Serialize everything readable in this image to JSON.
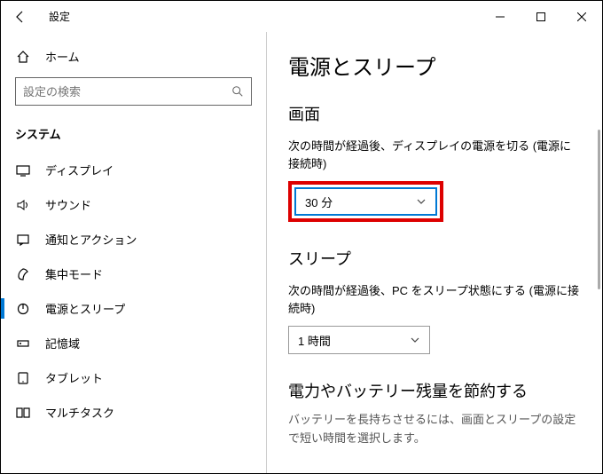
{
  "window": {
    "title": "設定",
    "minimize": "−",
    "maximize": "□",
    "close": "×"
  },
  "sidebar": {
    "home": "ホーム",
    "search_placeholder": "設定の検索",
    "category": "システム",
    "items": [
      {
        "label": "ディスプレイ"
      },
      {
        "label": "サウンド"
      },
      {
        "label": "通知とアクション"
      },
      {
        "label": "集中モード"
      },
      {
        "label": "電源とスリープ"
      },
      {
        "label": "記憶域"
      },
      {
        "label": "タブレット"
      },
      {
        "label": "マルチタスク"
      }
    ]
  },
  "main": {
    "title": "電源とスリープ",
    "screen_section": "画面",
    "screen_label": "次の時間が経過後、ディスプレイの電源を切る (電源に接続時)",
    "screen_value": "30 分",
    "sleep_section": "スリープ",
    "sleep_label": "次の時間が経過後、PC をスリープ状態にする (電源に接続時)",
    "sleep_value": "1 時間",
    "power_section": "電力やバッテリー残量を節約する",
    "power_help": "バッテリーを長持ちさせるには、画面とスリープの設定で短い時間を選択します。"
  }
}
